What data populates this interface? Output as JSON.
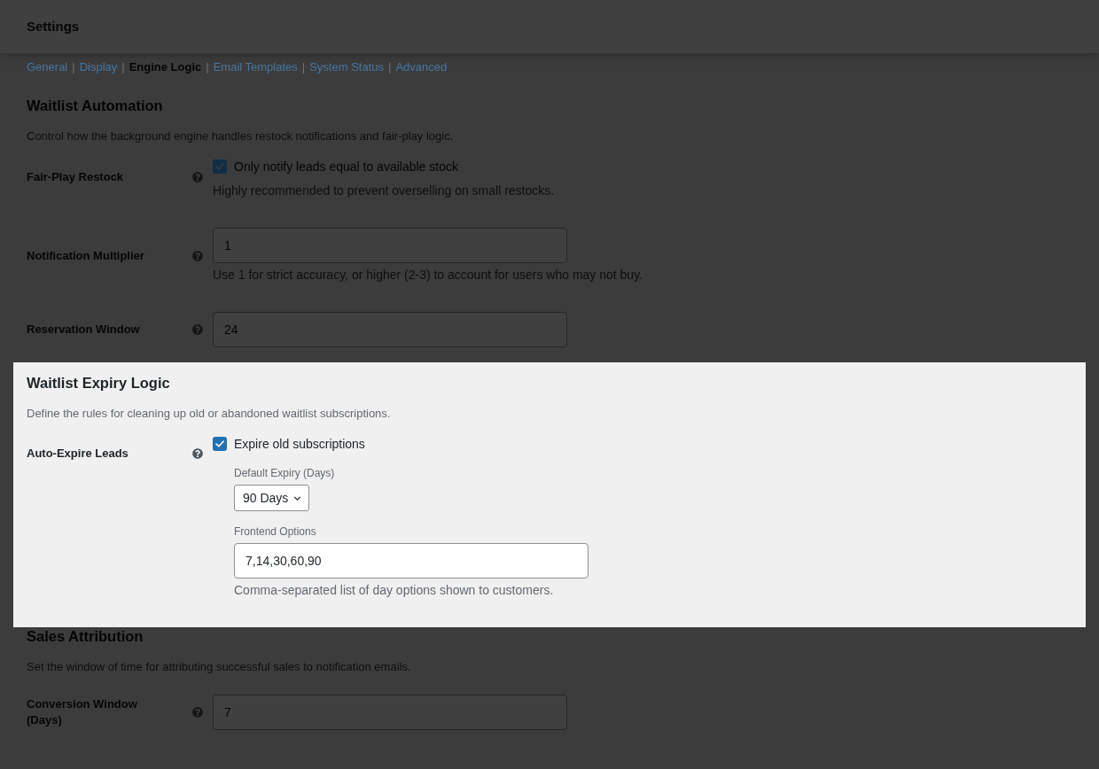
{
  "header": {
    "title": "Settings"
  },
  "nav": {
    "separator": "|",
    "items": [
      {
        "label": "General",
        "selected": false
      },
      {
        "label": "Display",
        "selected": false
      },
      {
        "label": "Engine Logic",
        "selected": true
      },
      {
        "label": "Email Templates",
        "selected": false
      },
      {
        "label": "System Status",
        "selected": false
      },
      {
        "label": "Advanced",
        "selected": false
      }
    ]
  },
  "sections": [
    {
      "title": "Waitlist Automation",
      "description": "Control how the background engine handles restock notifications and fair-play logic.",
      "highlighted": false,
      "fields": [
        {
          "kind": "checkbox",
          "label": "Fair-Play Restock",
          "checkbox_label": "Only notify leads equal to available stock",
          "checked": true,
          "description": "Highly recommended to prevent overselling on small restocks."
        },
        {
          "kind": "text",
          "label": "Notification Multiplier",
          "value": "1",
          "description": "Use 1 for strict accuracy, or higher (2-3) to account for users who may not buy."
        },
        {
          "kind": "text",
          "label": "Reservation Window",
          "value": "24"
        }
      ]
    },
    {
      "title": "Waitlist Expiry Logic",
      "description": "Define the rules for cleaning up old or abandoned waitlist subscriptions.",
      "highlighted": true,
      "fields": [
        {
          "kind": "expiry",
          "label": "Auto-Expire Leads",
          "checkbox_label": "Expire old subscriptions",
          "checked": true,
          "expiry": {
            "label": "Default Expiry (Days)",
            "value": "90 Days"
          },
          "options": {
            "label": "Frontend Options",
            "value": "7,14,30,60,90",
            "description": "Comma-separated list of day options shown to customers."
          }
        }
      ]
    },
    {
      "title": "Sales Attribution",
      "description": "Set the window of time for attributing successful sales to notification emails.",
      "highlighted": false,
      "fields": [
        {
          "kind": "text",
          "label": "Conversion Window (Days)",
          "value": "7"
        }
      ]
    }
  ]
}
